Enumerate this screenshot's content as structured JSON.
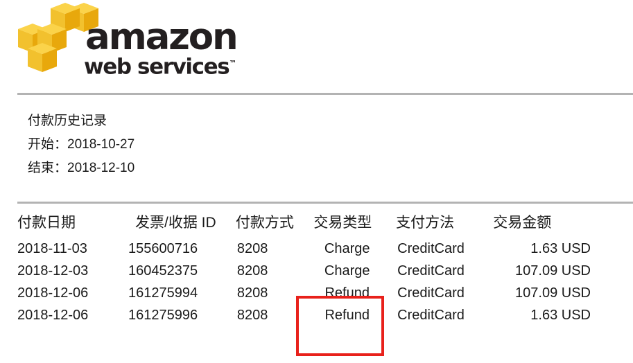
{
  "brand": {
    "logo_icon": "aws-cubes-logo",
    "wordmark_primary": "amazon",
    "wordmark_secondary": "web services",
    "trademark": "™",
    "yellow": "#F2C12E",
    "yellow_dark": "#E8A80C",
    "yellow_light": "#FBD34A",
    "text_color": "#231F20"
  },
  "summary": {
    "title": "付款历史记录",
    "start_label": "开始：2018-10-27",
    "end_label": "结束：2018-12-10"
  },
  "table": {
    "headers": {
      "date": "付款日期",
      "invoice": "发票/收据 ID",
      "payment_id": "付款方式",
      "transaction_type": "交易类型",
      "payment_method": "支付方法",
      "amount": "交易金额"
    },
    "rows": [
      {
        "date": "2018-11-03",
        "invoice": "155600716",
        "payment_id": "8208",
        "transaction_type": "Charge",
        "payment_method": "CreditCard",
        "amount": "1.63 USD"
      },
      {
        "date": "2018-12-03",
        "invoice": "160452375",
        "payment_id": "8208",
        "transaction_type": "Charge",
        "payment_method": "CreditCard",
        "amount": "107.09 USD"
      },
      {
        "date": "2018-12-06",
        "invoice": "161275994",
        "payment_id": "8208",
        "transaction_type": "Refund",
        "payment_method": "CreditCard",
        "amount": "107.09 USD"
      },
      {
        "date": "2018-12-06",
        "invoice": "161275996",
        "payment_id": "8208",
        "transaction_type": "Refund",
        "payment_method": "CreditCard",
        "amount": "1.63 USD"
      }
    ]
  },
  "annotation": {
    "highlight_color": "#E8211B",
    "highlight_target": "交易类型"
  }
}
